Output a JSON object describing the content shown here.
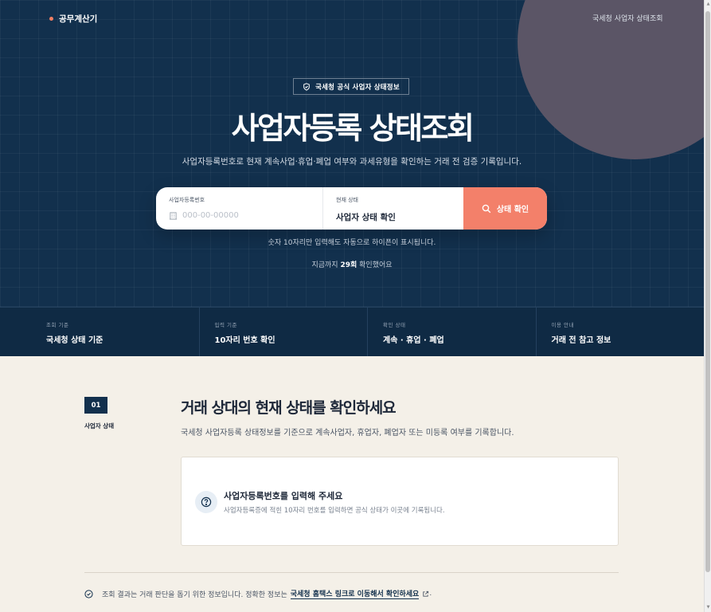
{
  "header": {
    "brand": "공무계산기",
    "top_link": "국세청 사업자 상태조회"
  },
  "hero": {
    "badge": "국세청 공식 사업자 상태정보",
    "title": "사업자등록 상태조회",
    "subtitle": "사업자등록번호로 현재 계속사업·휴업·폐업 여부와 과세유형을 확인하는 거래 전 검증 기록입니다."
  },
  "search": {
    "field_label": "사업자등록번호",
    "placeholder": "000-00-00000",
    "status_label": "현재 상태",
    "status_value": "사업자 상태 확인",
    "button_label": "상태 확인",
    "hint": "숫자 10자리만 입력해도 자동으로 하이픈이 표시됩니다.",
    "counter_prefix": "지금까지",
    "counter_value": "29회",
    "counter_suffix": "확인했어요"
  },
  "info_bar": [
    {
      "label": "조회 기준",
      "value": "국세청 상태 기준"
    },
    {
      "label": "입력 기준",
      "value": "10자리 번호 확인"
    },
    {
      "label": "확인 상태",
      "value": "계속 · 휴업 · 폐업"
    },
    {
      "label": "이용 안내",
      "value": "거래 전 참고 정보"
    }
  ],
  "section": {
    "step_number": "01",
    "step_label": "사업자 상태",
    "title": "거래 상대의 현재 상태를 확인하세요",
    "description": "국세청 사업자등록 상태정보를 기준으로 계속사업자, 휴업자, 폐업자 또는 미등록 여부를 기록합니다."
  },
  "result": {
    "title": "사업자등록번호를 입력해 주세요",
    "description": "사업자등록증에 적힌 10자리 번호를 입력하면 공식 상태가 이곳에 기록됩니다."
  },
  "footnote": {
    "text": "조회 결과는 거래 판단을 돕기 위한 정보입니다. 정확한 정보는",
    "link": "국세청 홈택스 링크로 이동해서 확인하세요",
    "end": "."
  },
  "colors": {
    "navy": "#12304d",
    "accent": "#f3806a",
    "background": "#f4f0e8"
  },
  "icons": [
    "shield-icon",
    "building-icon",
    "search-icon",
    "question-icon",
    "check-circle-icon",
    "external-link-icon"
  ]
}
